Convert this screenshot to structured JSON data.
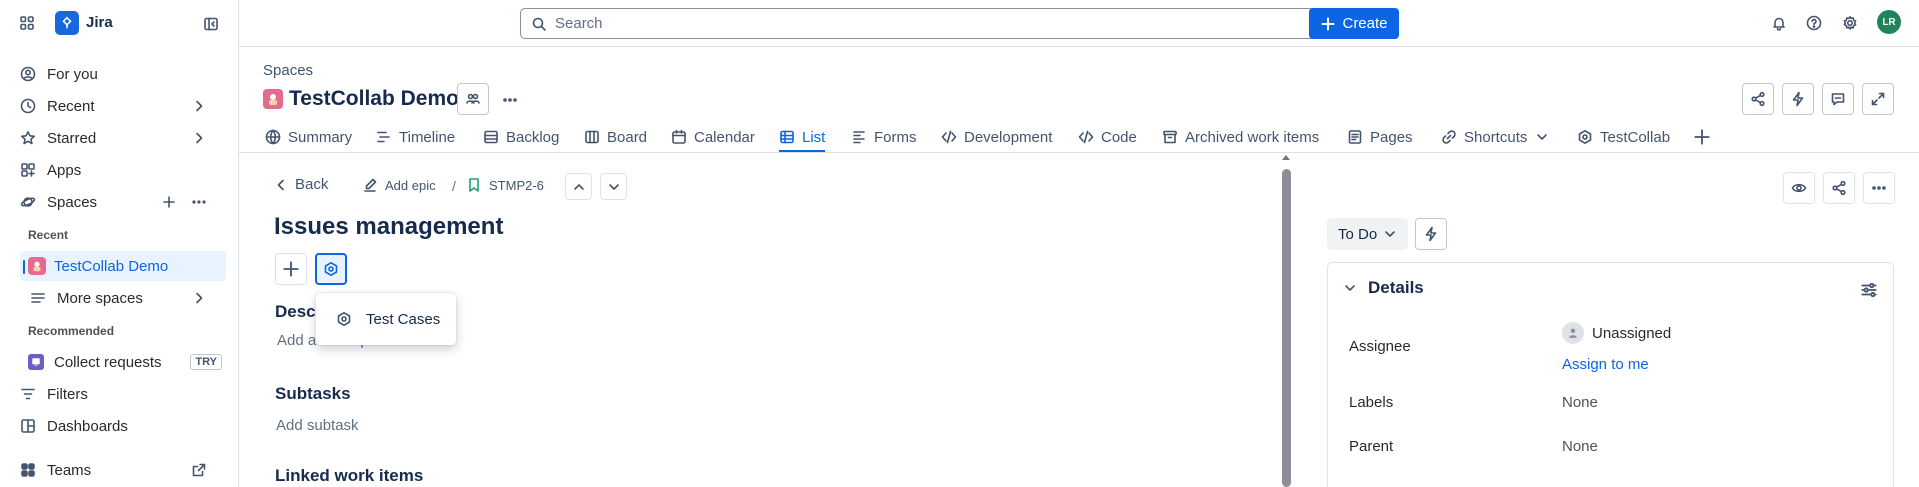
{
  "app": {
    "name": "Jira"
  },
  "topbar": {
    "search_placeholder": "Search",
    "create_label": "Create",
    "avatar_initials": "LR"
  },
  "sidebar": {
    "items": [
      {
        "label": "For you",
        "icon": "person-icon"
      },
      {
        "label": "Recent",
        "icon": "clock-icon"
      },
      {
        "label": "Starred",
        "icon": "star-icon"
      },
      {
        "label": "Apps",
        "icon": "apps-icon"
      },
      {
        "label": "Spaces",
        "icon": "spaces-icon"
      }
    ],
    "recent_heading": "Recent",
    "recent_space": "TestCollab Demo",
    "more_spaces": "More spaces",
    "recommended_heading": "Recommended",
    "collect_requests": "Collect requests",
    "try_badge": "TRY",
    "filters": "Filters",
    "dashboards": "Dashboards",
    "teams": "Teams"
  },
  "space": {
    "breadcrumb": "Spaces",
    "title": "TestCollab Demo"
  },
  "tabs": [
    {
      "label": "Summary"
    },
    {
      "label": "Timeline"
    },
    {
      "label": "Backlog"
    },
    {
      "label": "Board"
    },
    {
      "label": "Calendar"
    },
    {
      "label": "List"
    },
    {
      "label": "Forms"
    },
    {
      "label": "Development"
    },
    {
      "label": "Code"
    },
    {
      "label": "Archived work items"
    },
    {
      "label": "Pages"
    },
    {
      "label": "Shortcuts"
    },
    {
      "label": "TestCollab"
    }
  ],
  "issue": {
    "back_label": "Back",
    "add_epic_label": "Add epic",
    "separator": "/",
    "key": "STMP2-6",
    "title": "Issues management",
    "description_heading": "Desc",
    "description_placeholder": "Add a description...",
    "subtasks_heading": "Subtasks",
    "add_subtask": "Add subtask",
    "linked_heading": "Linked work items",
    "popup_item": "Test Cases"
  },
  "details": {
    "status": "To Do",
    "heading": "Details",
    "assignee_label": "Assignee",
    "assignee_value": "Unassigned",
    "assign_to_me": "Assign to me",
    "labels_label": "Labels",
    "labels_value": "None",
    "parent_label": "Parent",
    "parent_value": "None"
  },
  "colors": {
    "brand": "#0c66e4",
    "avatar": "#1f845a"
  }
}
